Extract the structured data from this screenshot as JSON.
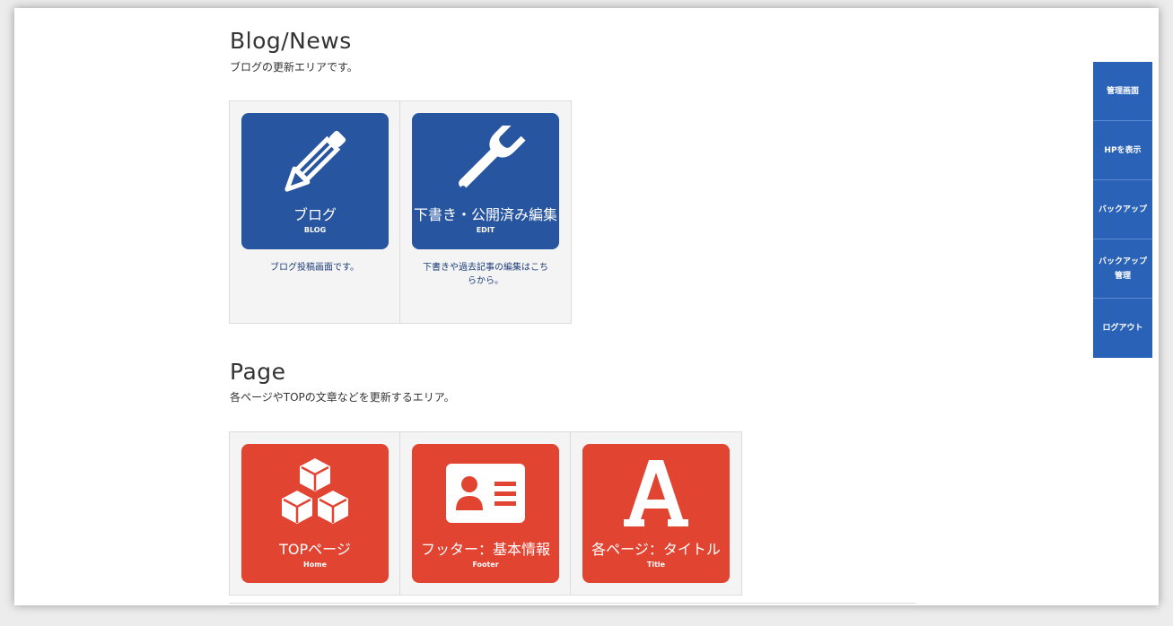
{
  "blog_section": {
    "title": "Blog/News",
    "description": "ブログの更新エリアです。",
    "tiles": [
      {
        "title": "ブログ",
        "sub": "BLOG",
        "icon": "pencil-icon",
        "description": "ブログ投稿画面です。"
      },
      {
        "title": "下書き・公開済み編集",
        "sub": "EDIT",
        "icon": "wrench-icon",
        "description": "下書きや過去記事の編集はこちらから。"
      }
    ]
  },
  "page_section": {
    "title": "Page",
    "description": "各ページやTOPの文章などを更新するエリア。",
    "tiles": [
      {
        "title": "TOPページ",
        "sub": "Home",
        "icon": "cubes-icon"
      },
      {
        "title": "フッター：基本情報",
        "sub": "Footer",
        "icon": "id-card-icon"
      },
      {
        "title": "各ページ：タイトル",
        "sub": "Title",
        "icon": "letter-a-icon"
      }
    ]
  },
  "side_menu": {
    "items": [
      {
        "label": "管理画面"
      },
      {
        "label": "HPを表示"
      },
      {
        "label": "バックアップ"
      },
      {
        "label": "バックアップ管理"
      },
      {
        "label": "ログアウト"
      }
    ]
  },
  "colors": {
    "blog_tile": "#2755a0",
    "page_tile": "#e14431",
    "side_menu": "#2a62b8"
  }
}
